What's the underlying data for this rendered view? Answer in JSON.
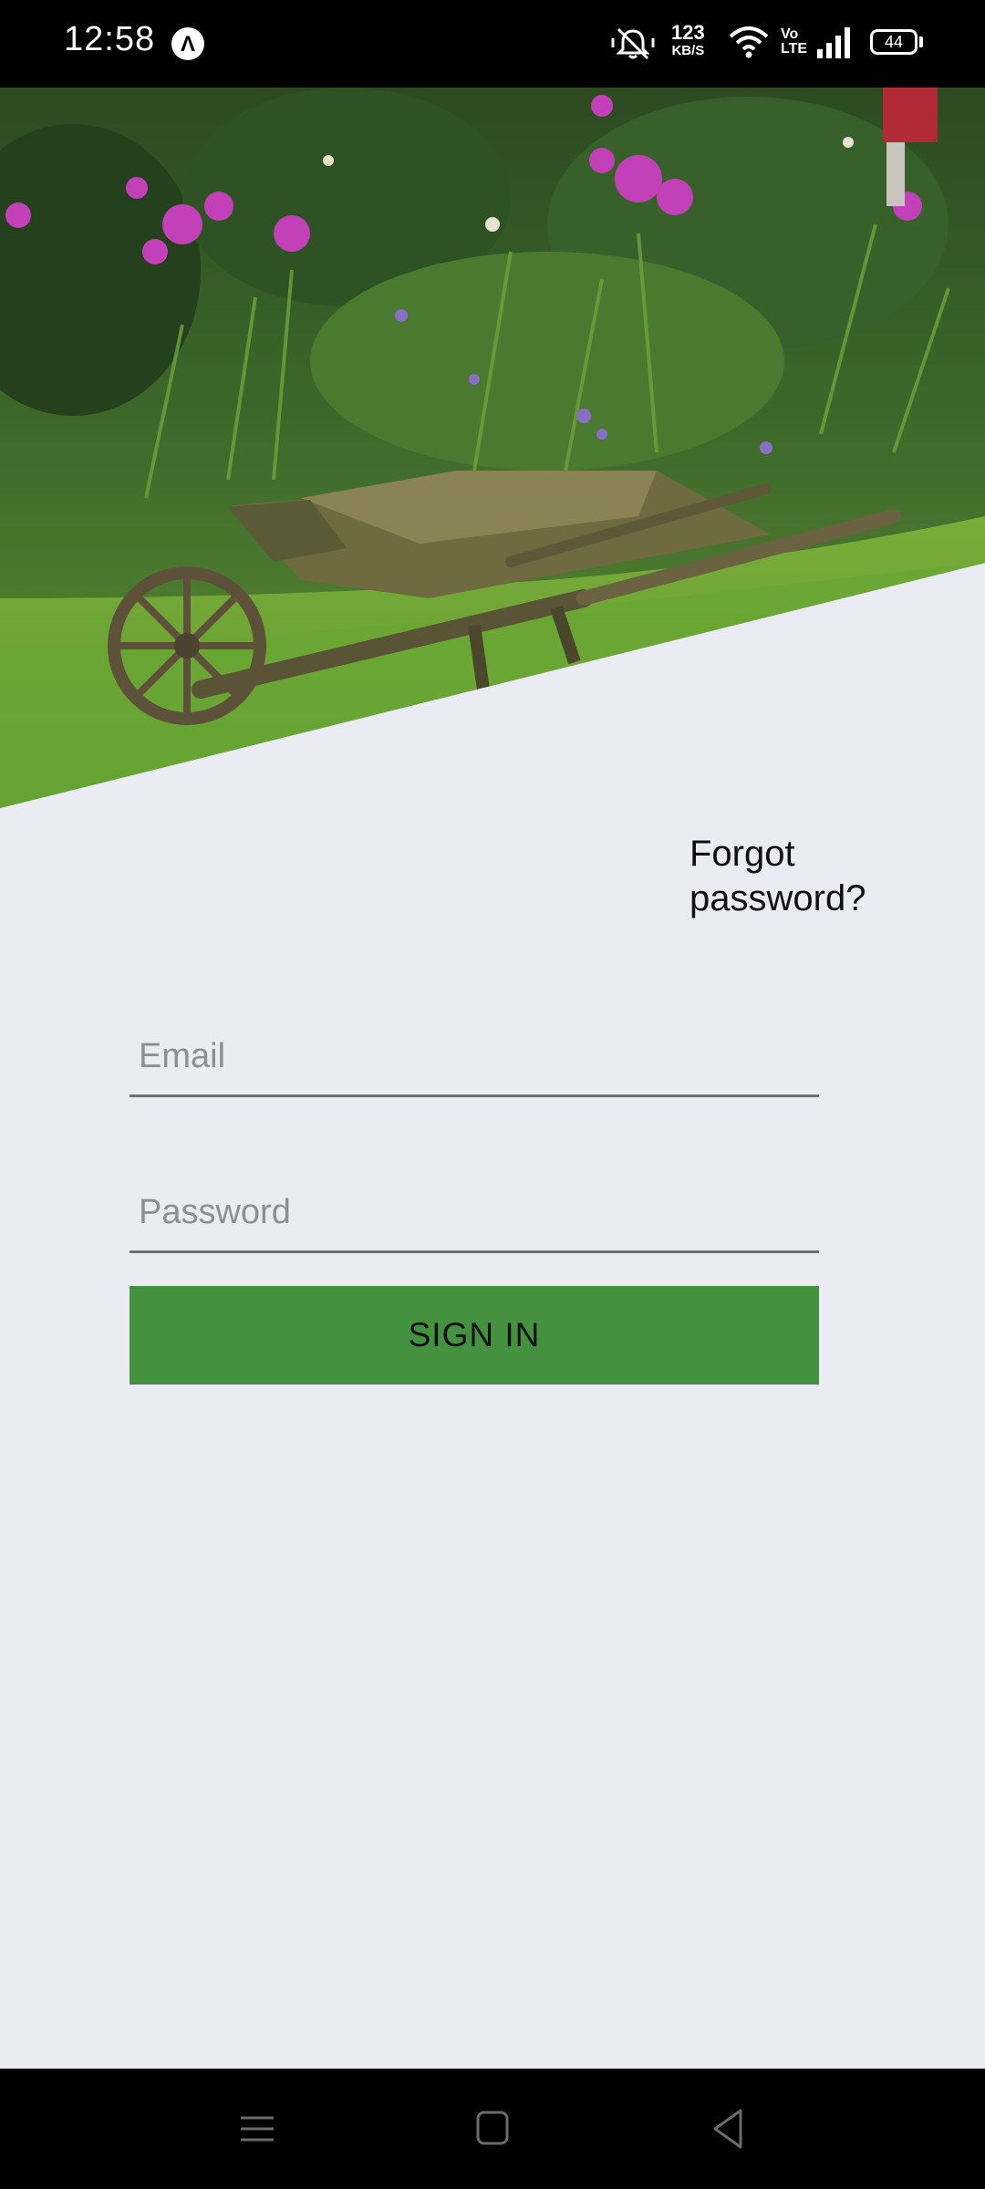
{
  "status_bar": {
    "time": "12:58",
    "app_badge": "Λ",
    "net_speed_value": "123",
    "net_speed_unit": "KB/S",
    "volte": "Vo LTE",
    "battery": "44",
    "icons": [
      "mute-icon",
      "wifi-icon",
      "signal-icon",
      "battery-icon"
    ]
  },
  "hero": {
    "icon": "garden-wheelbarrow-image"
  },
  "login": {
    "forgot_password": "Forgot password?",
    "email_placeholder": "Email",
    "password_placeholder": "Password",
    "sign_in_label": "SIGN IN"
  },
  "colors": {
    "background": "#eaebf3",
    "button": "#44913f",
    "bars": "#000000"
  },
  "nav_bar": {
    "icons": [
      "menu-icon",
      "home-icon",
      "back-icon"
    ]
  }
}
